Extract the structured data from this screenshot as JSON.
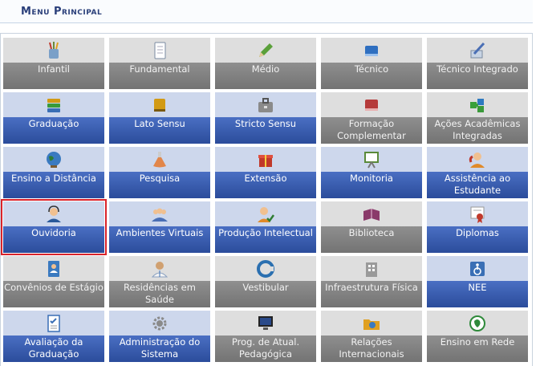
{
  "header": {
    "title": "Menu Principal"
  },
  "tiles": [
    {
      "label": "Infantil",
      "style": "gray",
      "icon": "pencil-cup-icon",
      "color": "#6a8a3a"
    },
    {
      "label": "Fundamental",
      "style": "gray",
      "icon": "notebook-icon",
      "color": "#cfd6df"
    },
    {
      "label": "Médio",
      "style": "gray",
      "icon": "pencil-icon",
      "color": "#5aa03a"
    },
    {
      "label": "Técnico",
      "style": "gray",
      "icon": "blue-book-icon",
      "color": "#2f6fc0"
    },
    {
      "label": "Técnico Integrado",
      "style": "gray",
      "icon": "drawing-pen-icon",
      "color": "#7a8aa0"
    },
    {
      "label": "Graduação",
      "style": "blue",
      "icon": "book-stack-icon",
      "color": "#3a9a3a"
    },
    {
      "label": "Lato Sensu",
      "style": "blue",
      "icon": "gold-book-icon",
      "color": "#d29a14"
    },
    {
      "label": "Stricto Sensu",
      "style": "blue",
      "icon": "briefcase-icon",
      "color": "#8a8a8a"
    },
    {
      "label": "Formação Complementar",
      "style": "gray",
      "icon": "red-book-icon",
      "color": "#b53a3a"
    },
    {
      "label": "Ações Acadêmicas Integradas",
      "style": "gray",
      "icon": "puzzle-icon",
      "color": "#3aa03a"
    },
    {
      "label": "Ensino a Distância",
      "style": "blue",
      "icon": "globe-icon",
      "color": "#2e7d32"
    },
    {
      "label": "Pesquisa",
      "style": "blue",
      "icon": "flask-icon",
      "color": "#e2864a"
    },
    {
      "label": "Extensão",
      "style": "blue",
      "icon": "gift-box-icon",
      "color": "#c0392b"
    },
    {
      "label": "Monitoria",
      "style": "blue",
      "icon": "presentation-board-icon",
      "color": "#5a8a3a"
    },
    {
      "label": "Assistência ao Estudante",
      "style": "blue",
      "icon": "user-support-icon",
      "color": "#e08a2a"
    },
    {
      "label": "Ouvidoria",
      "style": "blue",
      "icon": "headset-user-icon",
      "color": "#e08a2a",
      "selected": true
    },
    {
      "label": "Ambientes Virtuais",
      "style": "blue",
      "icon": "group-users-icon",
      "color": "#4a6fb5"
    },
    {
      "label": "Produção Intelectual",
      "style": "blue",
      "icon": "user-check-icon",
      "color": "#e08a2a"
    },
    {
      "label": "Biblioteca",
      "style": "gray",
      "icon": "open-book-icon",
      "color": "#8a3a6a"
    },
    {
      "label": "Diplomas",
      "style": "blue",
      "icon": "certificate-icon",
      "color": "#c0392b"
    },
    {
      "label": "Convênios de Estágio",
      "style": "gray",
      "icon": "contact-book-icon",
      "color": "#3a7ac0"
    },
    {
      "label": "Residências em Saúde",
      "style": "gray",
      "icon": "doctor-icon",
      "color": "#d0a070"
    },
    {
      "label": "Vestibular",
      "style": "gray",
      "icon": "c-logo-icon",
      "color": "#2a6fb0"
    },
    {
      "label": "Infraestrutura Física",
      "style": "gray",
      "icon": "building-icon",
      "color": "#9a9a9a"
    },
    {
      "label": "NEE",
      "style": "blue",
      "icon": "wheelchair-icon",
      "color": "#3a6fb5"
    },
    {
      "label": "Avaliação da Graduação",
      "style": "blue",
      "icon": "checklist-icon",
      "color": "#3a6fb5"
    },
    {
      "label": "Administração do Sistema",
      "style": "blue",
      "icon": "gear-icon",
      "color": "#8a8a8a"
    },
    {
      "label": "Prog. de Atual. Pedagógica",
      "style": "gray",
      "icon": "monitor-icon",
      "color": "#2a4a8a"
    },
    {
      "label": "Relações Internacionais",
      "style": "gray",
      "icon": "world-folder-icon",
      "color": "#e0a020"
    },
    {
      "label": "Ensino em Rede",
      "style": "gray",
      "icon": "network-map-icon",
      "color": "#2e8a3a"
    }
  ]
}
